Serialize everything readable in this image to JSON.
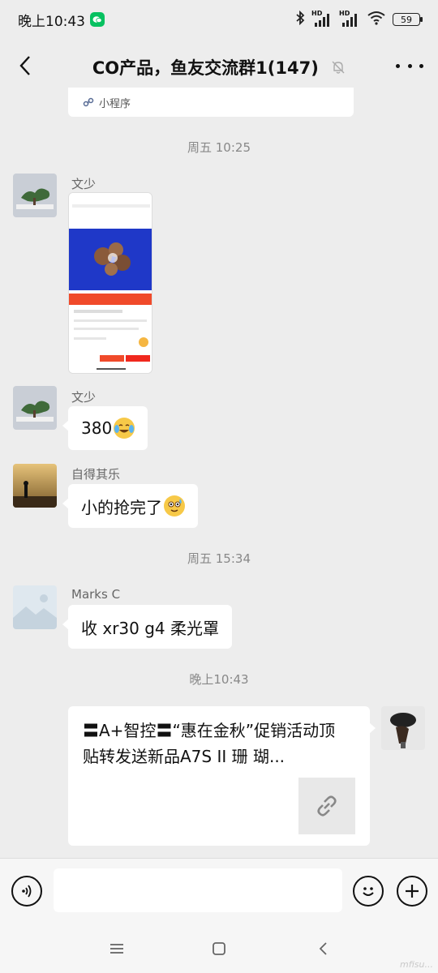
{
  "status_bar": {
    "time": "晚上10:43",
    "battery": "59",
    "network_labels": [
      "HD",
      "HD"
    ]
  },
  "header": {
    "title": "CO产品，鱼友交流群1(147)"
  },
  "mini_program": {
    "label": "小程序"
  },
  "messages": [
    {
      "type": "timestamp",
      "text": "周五 10:25"
    },
    {
      "type": "image",
      "sender": "文少"
    },
    {
      "type": "text",
      "sender": "文少",
      "text": "380"
    },
    {
      "type": "text",
      "sender": "自得其乐",
      "text": "小的抢完了"
    },
    {
      "type": "timestamp",
      "text": "周五 15:34"
    },
    {
      "type": "text",
      "sender": "Marks C",
      "text": "收 xr30 g4 柔光罩"
    },
    {
      "type": "timestamp",
      "text": "晚上10:43"
    },
    {
      "type": "link",
      "sender": "self",
      "title": "〓A+智控〓“惠在金秋”促销活动顶贴转发送新品A7S II 珊 瑚..."
    }
  ],
  "input": {
    "value": "",
    "placeholder": ""
  },
  "watermark": "mfisu...",
  "icons": {
    "back": "back-arrow-icon",
    "mute": "bell-off-icon",
    "more": "more-dots-icon",
    "voice": "voice-icon",
    "emoji": "emoji-icon",
    "plus": "plus-icon",
    "link": "link-icon",
    "nav_menu": "menu-icon",
    "nav_home": "home-icon",
    "nav_back": "back-icon"
  },
  "colors": {
    "background": "#ededed",
    "bubble": "#ffffff",
    "wechat_green": "#07c160",
    "toolbar": "#f6f6f6"
  }
}
